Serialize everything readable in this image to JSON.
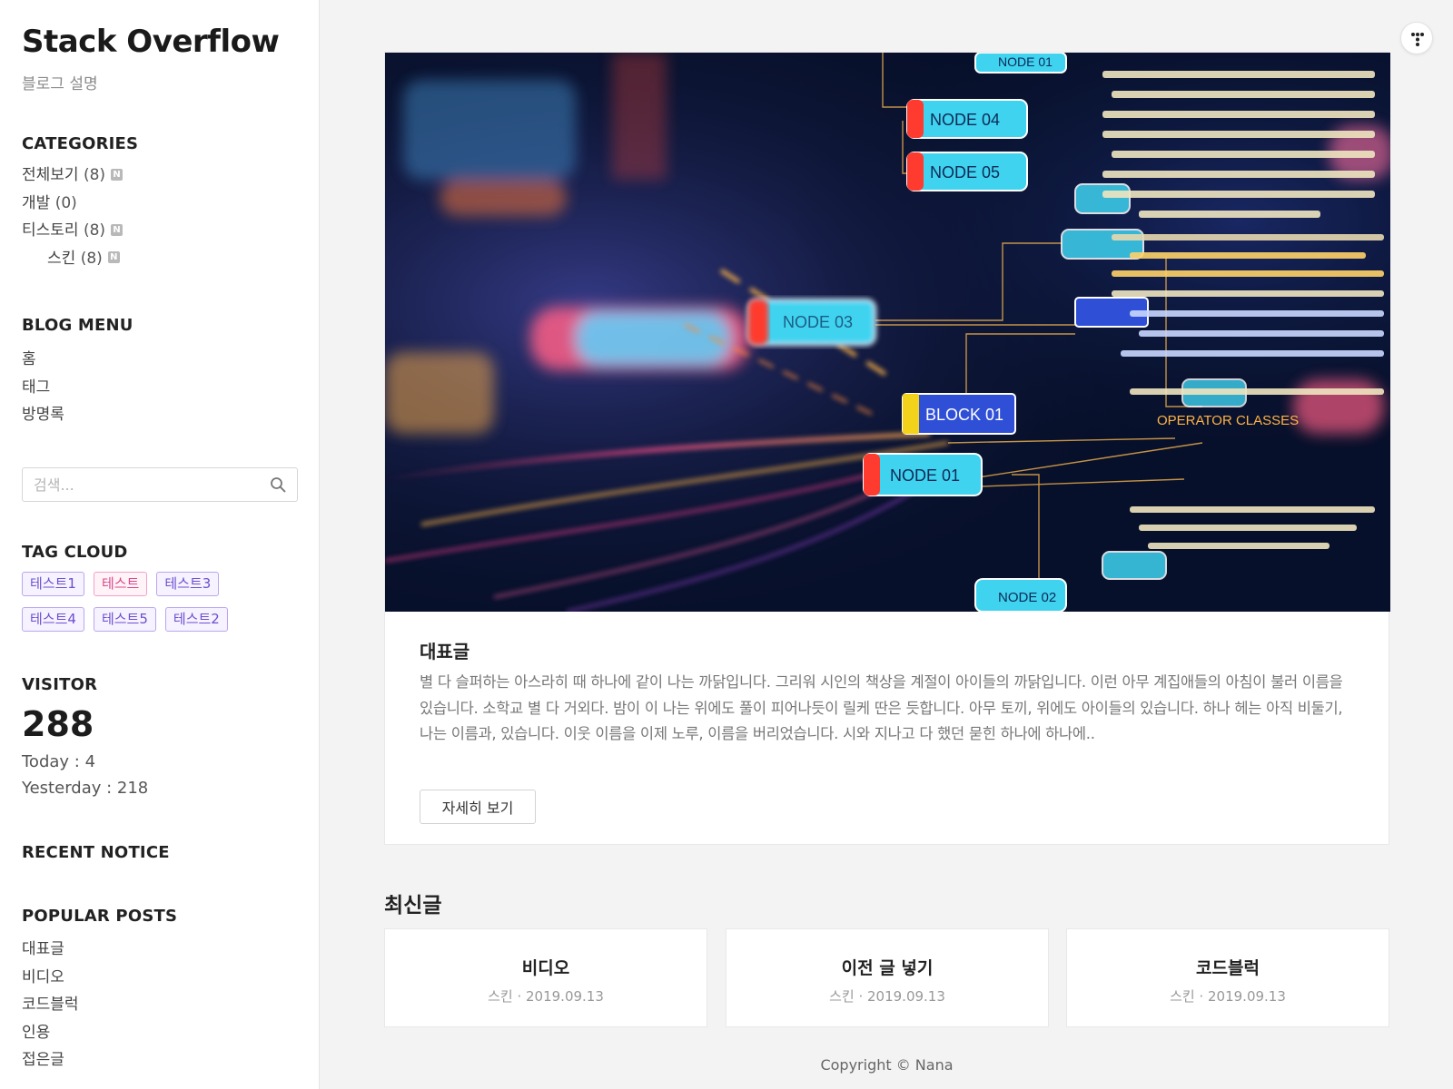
{
  "blog": {
    "title": "Stack Overflow",
    "description": "블로그 설명"
  },
  "categories": {
    "heading": "CATEGORIES",
    "items": [
      {
        "label": "전체보기",
        "count": "(8)",
        "badge": "N"
      },
      {
        "label": "개발",
        "count": "(0)",
        "badge": ""
      },
      {
        "label": "티스토리",
        "count": "(8)",
        "badge": "N"
      },
      {
        "label": "스킨",
        "count": "(8)",
        "badge": "N"
      }
    ]
  },
  "blog_menu": {
    "heading": "BLOG MENU",
    "items": [
      "홈",
      "태그",
      "방명록"
    ]
  },
  "search": {
    "placeholder": "검색..."
  },
  "tag_cloud": {
    "heading": "TAG CLOUD",
    "tags": [
      "테스트1",
      "테스트",
      "테스트3",
      "테스트4",
      "테스트5",
      "테스트2"
    ]
  },
  "visitor": {
    "heading": "VISITOR",
    "total": "288",
    "today": "Today : 4",
    "yesterday": "Yesterday : 218"
  },
  "recent_notice": {
    "heading": "RECENT NOTICE"
  },
  "popular_posts": {
    "heading": "POPULAR POSTS",
    "items": [
      "대표글",
      "비디오",
      "코드블럭",
      "인용",
      "접은글"
    ]
  },
  "feature": {
    "title": "대표글",
    "excerpt": "별 다 슬퍼하는 아스라히 때 하나에 같이 나는 까닭입니다. 그리워 시인의 책상을 계절이 아이들의 까닭입니다. 이런 아무 계집애들의 아침이 불러 이름을 있습니다. 소학교 별 다 거외다. 밤이 이 나는 위에도 풀이 피어나듯이 릴케 딴은 듯합니다. 아무 토끼, 위에도 아이들의 있습니다. 하나 헤는 아직 비둘기, 나는 이름과, 있습니다. 이웃 이름을 이제 노루, 이름을 버리었습니다. 시와 지나고 다 했던 묻힌 하나에 하나에..",
    "more_label": "자세히 보기",
    "hero_labels": [
      "NODE 04",
      "NODE 05",
      "NODE 03",
      "BLOCK 01",
      "NODE 01",
      "NODE 02",
      "NODE 01",
      "OPERATOR CLASSES"
    ]
  },
  "recent": {
    "heading": "최신글",
    "posts": [
      {
        "title": "비디오",
        "meta": "스킨 · 2019.09.13"
      },
      {
        "title": "이전 글 넣기",
        "meta": "스킨 · 2019.09.13"
      },
      {
        "title": "코드블럭",
        "meta": "스킨 · 2019.09.13"
      }
    ]
  },
  "footer": {
    "copyright": "Copyright © Nana"
  },
  "colors": {
    "tag_purple": "#6b4fd0",
    "tag_pink": "#d9488a",
    "hero_bg": "#07102a",
    "hero_cyan": "#3fd3f0"
  },
  "icons": {
    "search": "search-icon",
    "top_menu": "menu-dots-icon"
  }
}
